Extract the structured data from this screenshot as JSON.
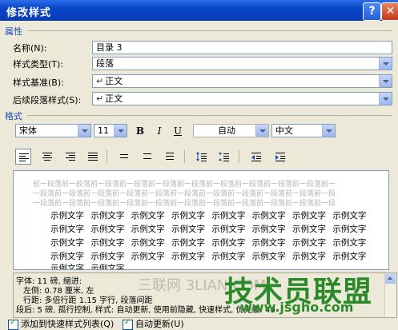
{
  "window": {
    "title": "修改样式",
    "help": "?",
    "close": "✕"
  },
  "properties": {
    "section_label": "属性",
    "name_label": "名称(N):",
    "name_value": "目录 3",
    "style_type_label": "样式类型(T):",
    "style_type_value": "段落",
    "based_on_label": "样式基准(B):",
    "based_on_value": "正文",
    "following_label": "后续段落样式(S):",
    "following_value": "正文"
  },
  "format": {
    "section_label": "格式",
    "font": "宋体",
    "size": "11",
    "bold": "B",
    "italic": "I",
    "underline": "U",
    "color": "自动",
    "language": "中文"
  },
  "preview": {
    "prev_para": [
      "前一段落前一段落前一段落前一段落前一段落前一段落前一段落前一段落前一段落前一段落前一",
      "一段落前一段落前一段落前一段落前一段落前一段落前一段落前一段落前一段落前一段落前一段",
      "一段落前一段落前一段落前一段落前一段落前一段落前一段落前一段落前一段落前一段落前一段"
    ],
    "sample_rows": [
      "示例文字 示例文字 示例文字 示例文字 示例文字 示例文字 示例文字 示例文字",
      "示例文字 示例文字 示例文字 示例文字 示例文字 示例文字 示例文字 示例文字",
      "示例文字 示例文字 示例文字 示例文字 示例文字 示例文字 示例文字 示例文字",
      "示例文字 示例文字 示例文字 示例文字 示例文字 示例文字 示例文字 示例文字",
      "示例文字 示例文字"
    ]
  },
  "description": {
    "line1": "字体: 11 磅, 缩进:",
    "line2": "左侧:  0.78 厘米, 左",
    "line3": "行距:  多倍行距 1.15 字行, 段落间距",
    "line4": "段后: 5 磅, 孤行控制, 样式: 自动更新, 使用前隐藏, 快速样式, 优先级: 40"
  },
  "options": {
    "add_to_quick": "添加到快速样式列表(Q)",
    "auto_update": "自动更新(U)"
  },
  "watermark": {
    "site1": "三联网 3LIAN.COM",
    "site2": "技术员联盟",
    "url": "www.jsgho.com"
  }
}
